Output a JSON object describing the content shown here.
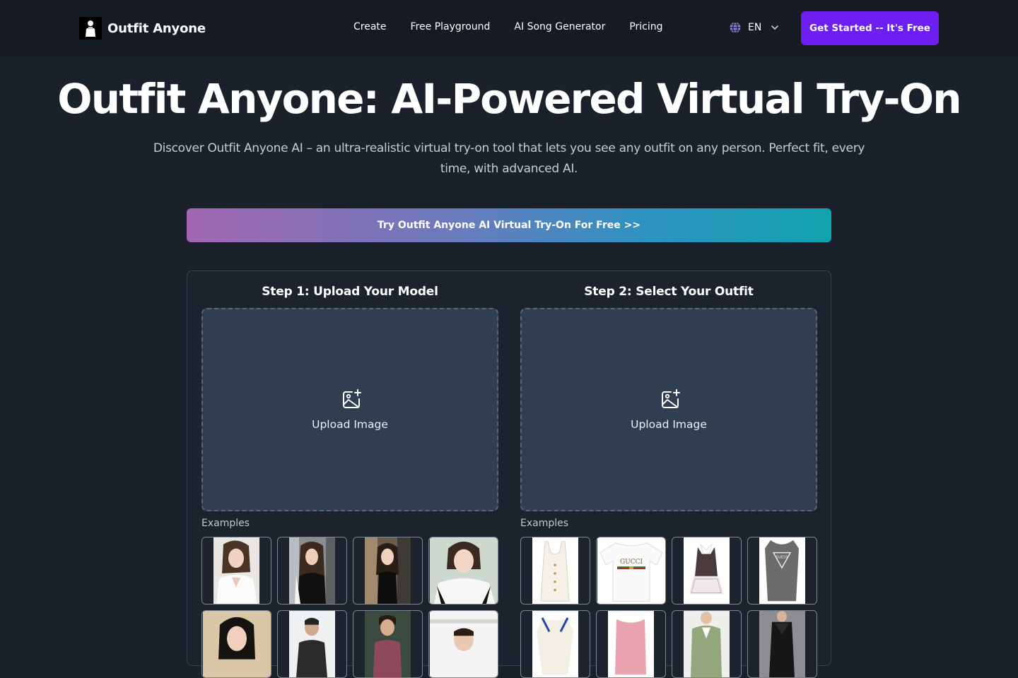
{
  "header": {
    "brand": "Outfit Anyone",
    "nav": [
      "Create",
      "Free Playground",
      "AI Song Generator",
      "Pricing"
    ],
    "language": "EN",
    "cta_label": "Get Started -- It's Free"
  },
  "hero": {
    "title": "Outfit Anyone: AI-Powered Virtual Try-On",
    "subtitle": "Discover Outfit Anyone AI – an ultra-realistic virtual try-on tool that lets you see any outfit on any person. Perfect fit, every time, with advanced AI.",
    "try_button": "Try Outfit Anyone AI Virtual Try-On For Free >>"
  },
  "steps": {
    "model": {
      "title": "Step 1: Upload Your Model",
      "upload_label": "Upload Image",
      "examples_label": "Examples"
    },
    "outfit": {
      "title": "Step 2: Select Your Outfit",
      "upload_label": "Upload Image",
      "examples_label": "Examples",
      "brand_prints": [
        "GUCCI",
        "GUESS"
      ]
    }
  },
  "colors": {
    "background": "#1b212b",
    "header_bg": "#161b23",
    "accent": "#6d1ef0",
    "dropzone_bg": "#313e52",
    "gradient_start": "#a166b0",
    "gradient_end": "#10a2ad"
  },
  "icons": [
    "globe-icon",
    "chevron-down-icon",
    "image-plus-icon"
  ]
}
